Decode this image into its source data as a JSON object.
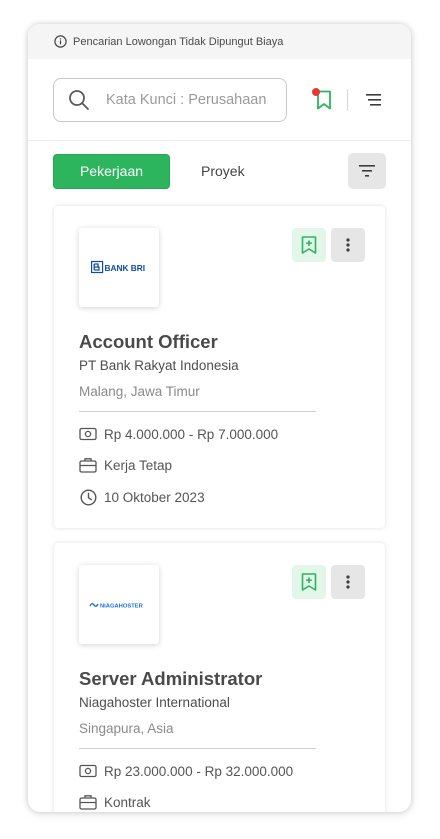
{
  "notice": {
    "text": "Pencarian Lowongan Tidak Dipungut Biaya",
    "icon": "info-icon"
  },
  "search": {
    "placeholder": "Kata Kunci : Perusahaan",
    "value": ""
  },
  "header": {
    "bookmark_icon": "bookmark-icon",
    "menu_icon": "menu-icon",
    "notification_dot_color": "#e53935"
  },
  "tabs": [
    {
      "label": "Pekerjaan",
      "active": true
    },
    {
      "label": "Proyek",
      "active": false
    }
  ],
  "colors": {
    "accent": "#2db55d",
    "accent_light": "#e3f6ea",
    "bri_blue": "#0d4ea3"
  },
  "jobs": [
    {
      "logo_text": "BANK BRI",
      "title": "Account Officer",
      "company": "PT Bank Rakyat Indonesia",
      "location": "Malang, Jawa Timur",
      "salary": "Rp 4.000.000 - Rp 7.000.000",
      "employment_type": "Kerja Tetap",
      "date": "10 Oktober 2023"
    },
    {
      "logo_text": "NIAGAHOSTER",
      "title": "Server Administrator",
      "company": "Niagahoster International",
      "location": "Singapura, Asia",
      "salary": "Rp 23.000.000 - Rp 32.000.000",
      "employment_type": "Kontrak"
    }
  ]
}
